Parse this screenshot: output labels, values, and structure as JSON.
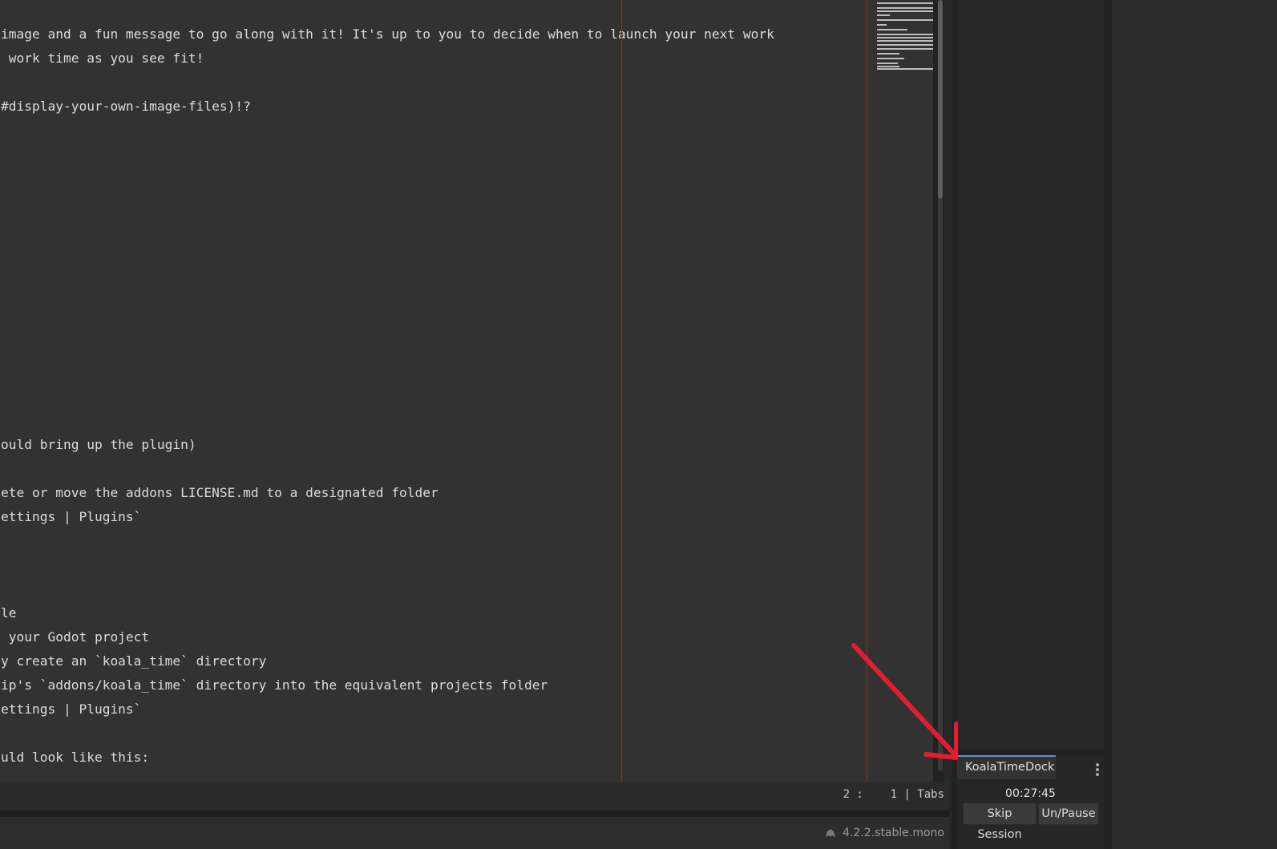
{
  "editor": {
    "lines": [
      "image and a fun message to go along with it! It's up to you to decide when to launch your next work",
      " work time as you see fit!",
      "#display-your-own-image-files)!?",
      "ould bring up the plugin)",
      "ete or move the addons LICENSE.md to a designated folder",
      "ettings | Plugins`",
      "le",
      " your Godot project",
      "y create an `koala_time` directory",
      "ip's `addons/koala_time` directory into the equivalent projects folder",
      "ettings | Plugins`",
      "uld look like this:"
    ]
  },
  "status": {
    "cursor": "2 :    1 | Tabs"
  },
  "footer": {
    "version": "4.2.2.stable.mono"
  },
  "dock": {
    "tab_label": "KoalaTimeDock",
    "timer": "00:27:45",
    "skip_label": "Skip Session",
    "pause_label": "Un/Pause"
  },
  "colors": {
    "accent": "#5c8fd6",
    "guide_line": "#9c2727",
    "annotation_arrow": "#e01e2e"
  }
}
